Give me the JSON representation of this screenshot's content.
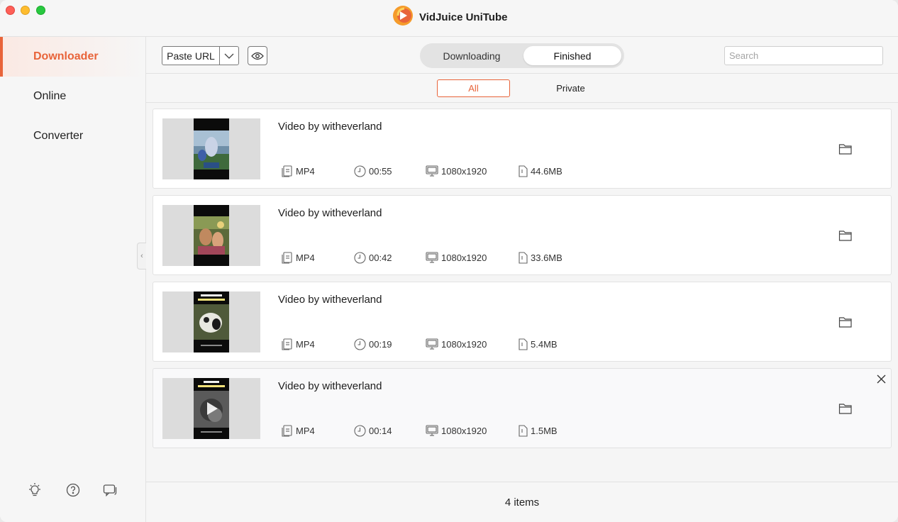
{
  "app": {
    "title": "VidJuice UniTube",
    "brand_color": "#e8643a"
  },
  "sidebar": {
    "items": [
      {
        "label": "Downloader",
        "active": true
      },
      {
        "label": "Online",
        "active": false
      },
      {
        "label": "Converter",
        "active": false
      }
    ],
    "bottom_icons": [
      "lightbulb-icon",
      "help-icon",
      "feedback-icon"
    ]
  },
  "toolbar": {
    "paste_label": "Paste URL",
    "tabs": [
      {
        "label": "Downloading",
        "selected": false
      },
      {
        "label": "Finished",
        "selected": true
      }
    ],
    "search": {
      "placeholder": "Search",
      "value": ""
    }
  },
  "filters": [
    {
      "label": "All",
      "selected": true
    },
    {
      "label": "Private",
      "selected": false
    }
  ],
  "videos": [
    {
      "title": "Video by witheverland",
      "format": "MP4",
      "duration": "00:55",
      "resolution": "1080x1920",
      "size": "44.6MB"
    },
    {
      "title": "Video by witheverland",
      "format": "MP4",
      "duration": "00:42",
      "resolution": "1080x1920",
      "size": "33.6MB"
    },
    {
      "title": "Video by witheverland",
      "format": "MP4",
      "duration": "00:19",
      "resolution": "1080x1920",
      "size": "5.4MB"
    },
    {
      "title": "Video by witheverland",
      "format": "MP4",
      "duration": "00:14",
      "resolution": "1080x1920",
      "size": "1.5MB"
    }
  ],
  "footer": {
    "count_text": "4 items"
  }
}
